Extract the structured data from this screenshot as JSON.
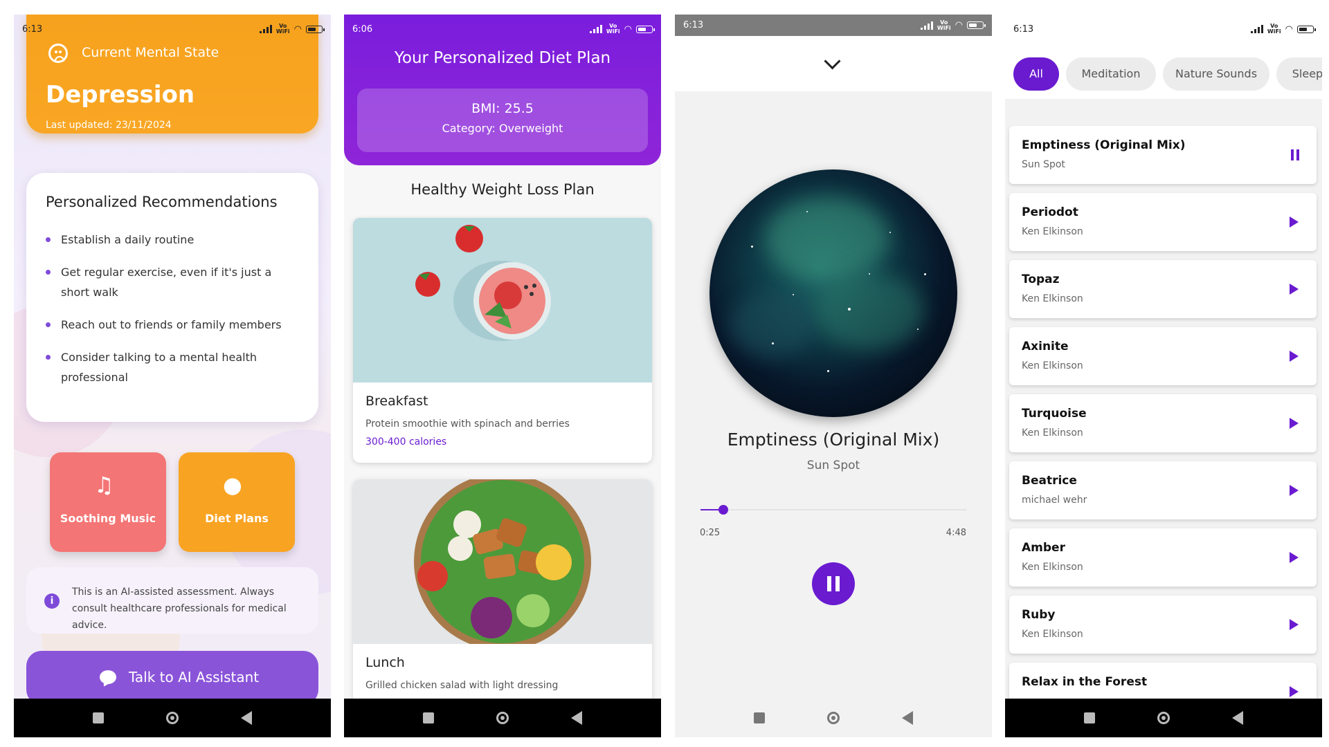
{
  "screen1": {
    "status_time": "6:13",
    "state_label": "Current Mental State",
    "state_value": "Depression",
    "last_updated": "Last updated: 23/11/2024",
    "recommendations_title": "Personalized Recommendations",
    "recommendations": [
      "Establish a daily routine",
      "Get regular exercise, even if it's just a short walk",
      "Reach out to friends or family members",
      "Consider talking to a mental health professional"
    ],
    "tiles": [
      {
        "label": "Soothing Music",
        "icon": "music-note-icon",
        "color": "#f47575"
      },
      {
        "label": "Diet Plans",
        "icon": "apple-icon",
        "color": "#f9a322"
      }
    ],
    "disclaimer": "This is an AI-assisted assessment. Always consult healthcare professionals for medical advice.",
    "ai_button": "Talk to AI Assistant"
  },
  "screen2": {
    "status_time": "6:06",
    "title": "Your Personalized Diet Plan",
    "bmi": "BMI: 25.5",
    "category": "Category: Overweight",
    "plan_title": "Healthy Weight Loss Plan",
    "meals": [
      {
        "name": "Breakfast",
        "description": "Protein smoothie with spinach and berries",
        "calories": "300-400 calories"
      },
      {
        "name": "Lunch",
        "description": "Grilled chicken salad with light dressing"
      }
    ]
  },
  "screen3": {
    "status_time": "6:13",
    "track_title": "Emptiness (Original Mix)",
    "artist": "Sun Spot",
    "time_current": "0:25",
    "time_total": "4:48",
    "progress": 0.087
  },
  "screen4": {
    "status_time": "6:13",
    "chips": [
      "All",
      "Meditation",
      "Nature Sounds",
      "Sleep"
    ],
    "active_chip": "All",
    "songs": [
      {
        "title": "Emptiness (Original Mix)",
        "artist": "Sun Spot",
        "state": "playing"
      },
      {
        "title": "Periodot",
        "artist": "Ken Elkinson",
        "state": "paused"
      },
      {
        "title": "Topaz",
        "artist": "Ken Elkinson",
        "state": "paused"
      },
      {
        "title": "Axinite",
        "artist": "Ken Elkinson",
        "state": "paused"
      },
      {
        "title": "Turquoise",
        "artist": "Ken Elkinson",
        "state": "paused"
      },
      {
        "title": "Beatrice",
        "artist": "michael wehr",
        "state": "paused"
      },
      {
        "title": "Amber",
        "artist": "Ken Elkinson",
        "state": "paused"
      },
      {
        "title": "Ruby",
        "artist": "Ken Elkinson",
        "state": "paused"
      },
      {
        "title": "Relax in the Forest",
        "artist": "",
        "state": "paused"
      }
    ]
  },
  "colors": {
    "accent_purple": "#6a1bd0",
    "orange": "#f7a21d",
    "coral": "#f47575",
    "lavender_button": "#8a54d9"
  }
}
